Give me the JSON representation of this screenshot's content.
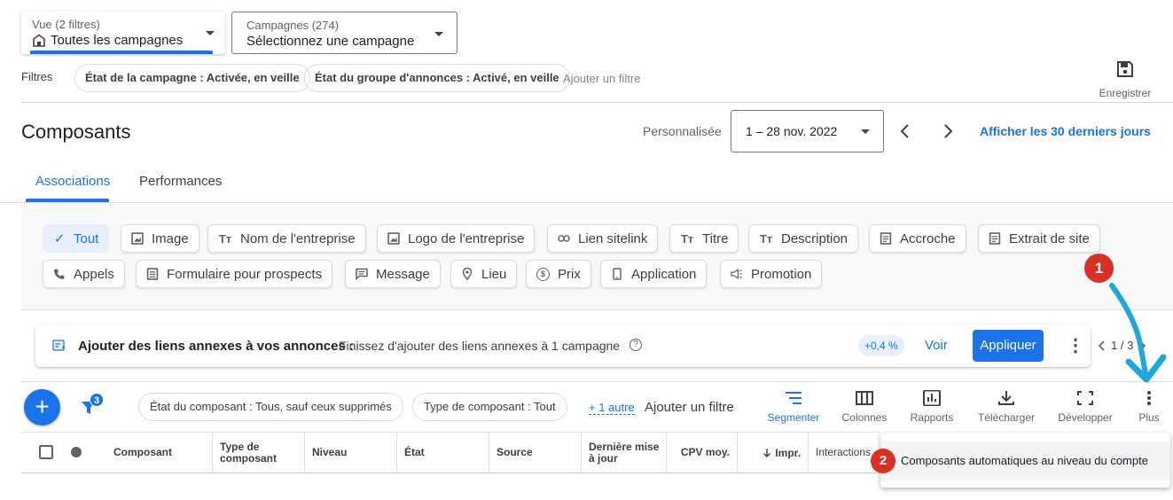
{
  "view_selector": {
    "caption": "Vue (2 filtres)",
    "value": "Toutes les campagnes"
  },
  "campaign_selector": {
    "caption": "Campagnes (274)",
    "value": "Sélectionnez une campagne"
  },
  "filters": {
    "label": "Filtres",
    "chips": [
      "État de la campagne : Activée, en veille",
      "État du groupe d'annonces : Activé, en veille"
    ],
    "add_label": "Ajouter un filtre"
  },
  "save": {
    "label": "Enregistrer"
  },
  "page": {
    "title": "Composants"
  },
  "date": {
    "mode": "Personnalisée",
    "range": "1 – 28 nov. 2022",
    "shortcut": "Afficher les 30 derniers jours"
  },
  "tabs": {
    "associations": "Associations",
    "performances": "Performances"
  },
  "asset_types": {
    "row1": [
      "Tout",
      "Image",
      "Nom de l'entreprise",
      "Logo de l'entreprise",
      "Lien sitelink",
      "Titre",
      "Description",
      "Accroche",
      "Extrait de site"
    ],
    "row2": [
      "Appels",
      "Formulaire pour prospects",
      "Message",
      "Lieu",
      "Prix",
      "Application",
      "Promotion"
    ]
  },
  "recommendation": {
    "title": "Ajouter des liens annexes à vos annonces :",
    "text": "Finissez d'ajouter des liens annexes à 1 campagne",
    "help": "?",
    "uplift": "+0,4 %",
    "view": "Voir",
    "apply": "Appliquer",
    "pager": "1 / 3"
  },
  "toolbar": {
    "add": "+",
    "filter_count": "3",
    "chips": [
      "État du composant : Tous, sauf ceux supprimés",
      "Type de composant : Tout"
    ],
    "more_filters": "+ 1 autre",
    "add_filter": "Ajouter un filtre",
    "buttons": [
      "Segmenter",
      "Colonnes",
      "Rapports",
      "Télécharger",
      "Développer",
      "Plus"
    ]
  },
  "table": {
    "headers": [
      "Composant",
      "Type de\ncomposant",
      "Niveau",
      "État",
      "Source",
      "Dernière mise\nà jour",
      "CPV moy.",
      "Impr.",
      "Interactions"
    ]
  },
  "menu": {
    "item": "Composants automatiques au niveau du compte"
  },
  "annotations": {
    "step1": "1",
    "step2": "2"
  },
  "colors": {
    "accent": "#1a73e8",
    "annotation_red": "#d93025",
    "arrow": "#1ea7d8"
  }
}
